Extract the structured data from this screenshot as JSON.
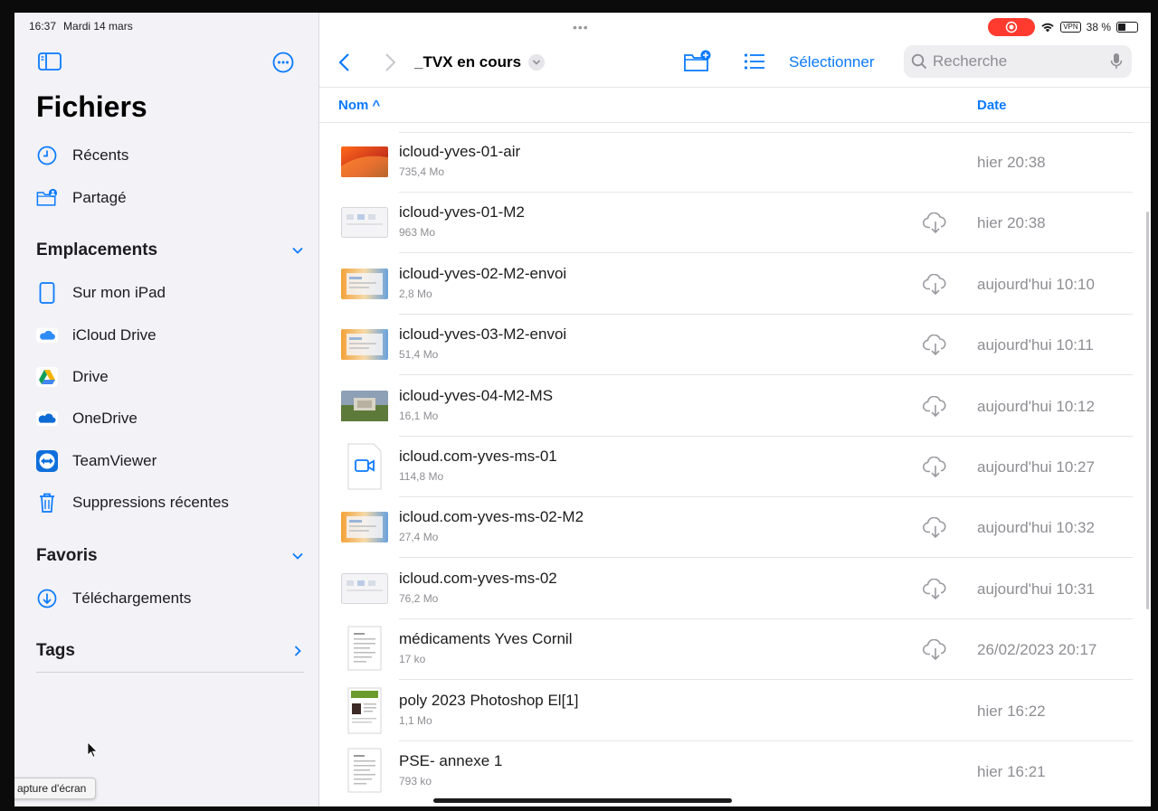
{
  "status": {
    "time": "16:37",
    "date": "Mardi 14 mars",
    "multitask_dots": "•••",
    "vpn": "VPN",
    "battery": "38 %",
    "battery_level": 0.38
  },
  "sidebar": {
    "title": "Fichiers",
    "top_items": [
      {
        "label": "Récents",
        "icon": "clock-icon"
      },
      {
        "label": "Partagé",
        "icon": "shared-folder-icon"
      }
    ],
    "locations_header": "Emplacements",
    "locations": [
      {
        "label": "Sur mon iPad",
        "icon": "ipad-icon"
      },
      {
        "label": "iCloud Drive",
        "icon": "icloud-icon"
      },
      {
        "label": "Drive",
        "icon": "google-drive-icon"
      },
      {
        "label": "OneDrive",
        "icon": "onedrive-icon"
      },
      {
        "label": "TeamViewer",
        "icon": "teamviewer-icon"
      },
      {
        "label": "Suppressions récentes",
        "icon": "trash-icon"
      }
    ],
    "favorites_header": "Favoris",
    "favorites": [
      {
        "label": "Téléchargements",
        "icon": "download-icon"
      }
    ],
    "tags_header": "Tags",
    "tooltip": "apture d'écran"
  },
  "toolbar": {
    "folder_title": "_TVX en cours",
    "select_label": "Sélectionner",
    "search_placeholder": "Recherche"
  },
  "columns": {
    "name": "Nom ^",
    "date": "Date"
  },
  "files": [
    {
      "name": "icloud-yves-01-air",
      "size": "735,4 Mo",
      "date": "hier 20:38",
      "cloud": false,
      "thumb": "orange"
    },
    {
      "name": "icloud-yves-01-M2",
      "size": "963 Mo",
      "date": "hier 20:38",
      "cloud": true,
      "thumb": "gray"
    },
    {
      "name": "icloud-yves-02-M2-envoi",
      "size": "2,8 Mo",
      "date": "aujourd'hui 10:10",
      "cloud": true,
      "thumb": "screen"
    },
    {
      "name": "icloud-yves-03-M2-envoi",
      "size": "51,4 Mo",
      "date": "aujourd'hui 10:11",
      "cloud": true,
      "thumb": "screen"
    },
    {
      "name": "icloud-yves-04-M2-MS",
      "size": "16,1 Mo",
      "date": "aujourd'hui 10:12",
      "cloud": true,
      "thumb": "photo"
    },
    {
      "name": "icloud.com-yves-ms-01",
      "size": "114,8 Mo",
      "date": "aujourd'hui 10:27",
      "cloud": true,
      "thumb": "video"
    },
    {
      "name": "icloud.com-yves-ms-02-M2",
      "size": "27,4 Mo",
      "date": "aujourd'hui 10:32",
      "cloud": true,
      "thumb": "screen"
    },
    {
      "name": "icloud.com-yves-ms-02",
      "size": "76,2 Mo",
      "date": "aujourd'hui 10:31",
      "cloud": true,
      "thumb": "gray"
    },
    {
      "name": "médicaments Yves Cornil",
      "size": "17 ko",
      "date": "26/02/2023 20:17",
      "cloud": true,
      "thumb": "doc"
    },
    {
      "name": "poly 2023 Photoshop El[1]",
      "size": "1,1 Mo",
      "date": "hier 16:22",
      "cloud": false,
      "thumb": "pdf"
    },
    {
      "name": "PSE- annexe 1",
      "size": "793 ko",
      "date": "hier 16:21",
      "cloud": false,
      "thumb": "doc"
    }
  ],
  "colors": {
    "accent": "#0a7aff",
    "record": "#ff3b30"
  }
}
